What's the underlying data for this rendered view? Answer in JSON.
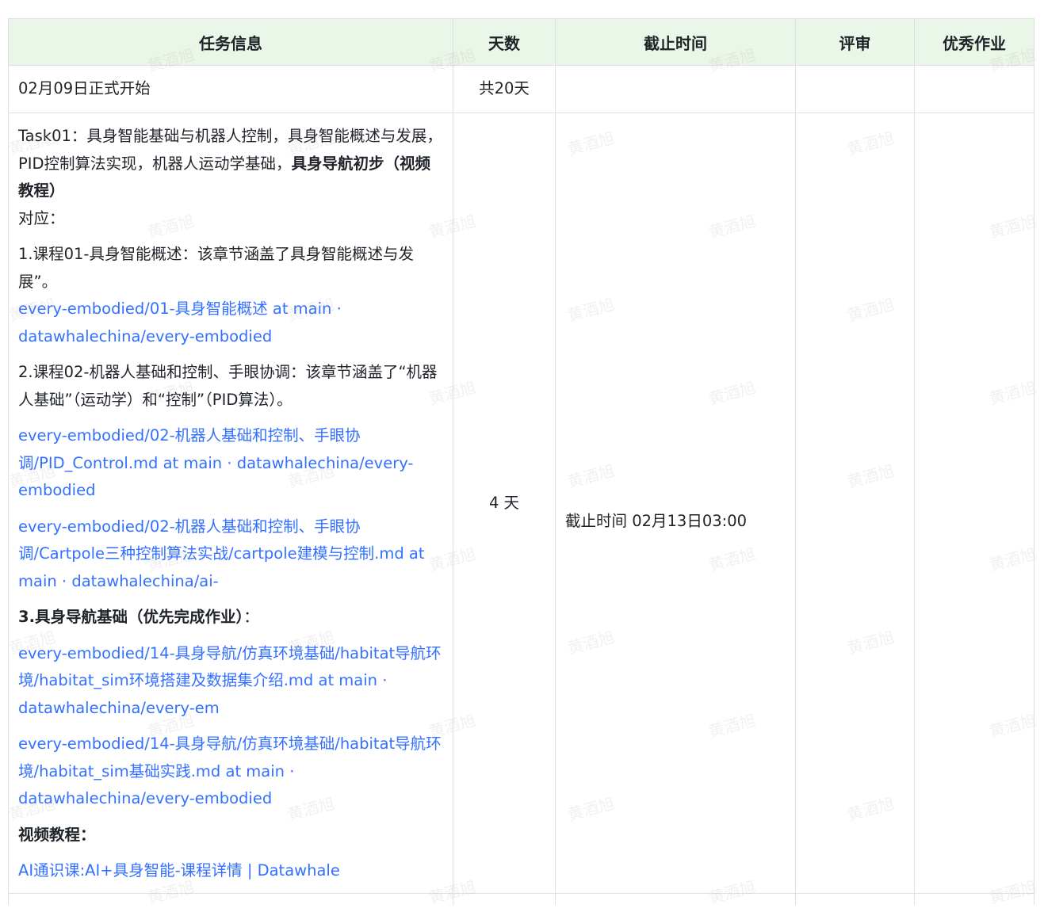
{
  "table": {
    "headers": [
      "任务信息",
      "天数",
      "截止时间",
      "评审",
      "优秀作业"
    ],
    "rows": [
      {
        "task": "02月09日正式开始",
        "days": "共20天",
        "deadline": "",
        "review": "",
        "excellent": ""
      }
    ],
    "task01": {
      "intro_plain": "Task01：具身智能基础与机器人控制，具身智能概述与发展，PID控制算法实现，机器人运动学基础，",
      "intro_bold": "具身导航初步（视频教程）",
      "correspond": "对应：",
      "course1": "1.课程01-具身智能概述：该章节涵盖了具身智能概述与发展”。",
      "link1": "every-embodied/01-具身智能概述 at main · datawhalechina/every-embodied",
      "course2": "2.课程02-机器人基础和控制、手眼协调：该章节涵盖了“机器人基础”（运动学）和“控制”（PID算法）。",
      "link2": "every-embodied/02-机器人基础和控制、手眼协调/PID_Control.md at main · datawhalechina/every-embodied",
      "link3": "every-embodied/02-机器人基础和控制、手眼协调/Cartpole三种控制算法实战/cartpole建模与控制.md at main · datawhalechina/ai-",
      "course3_bold": "3.具身导航基础（优先完成作业）",
      "course3_colon": "：",
      "link4": "every-embodied/14-具身导航/仿真环境基础/habitat导航环境/habitat_sim环境搭建及数据集介绍.md at main · datawhalechina/every-em",
      "link5": "every-embodied/14-具身导航/仿真环境基础/habitat导航环境/habitat_sim基础实践.md at main · datawhalechina/every-embodied",
      "video_label": "视频教程：",
      "link6": "AI通识课:AI+具身智能-课程详情 | Datawhale",
      "days": "4 天",
      "deadline": "截止时间 02月13日03:00",
      "review": "",
      "excellent": ""
    }
  },
  "watermark": "黄酒旭",
  "colors": {
    "header_bg": "#eaf6e8",
    "link": "#3370ff",
    "border": "#dee0e3"
  }
}
